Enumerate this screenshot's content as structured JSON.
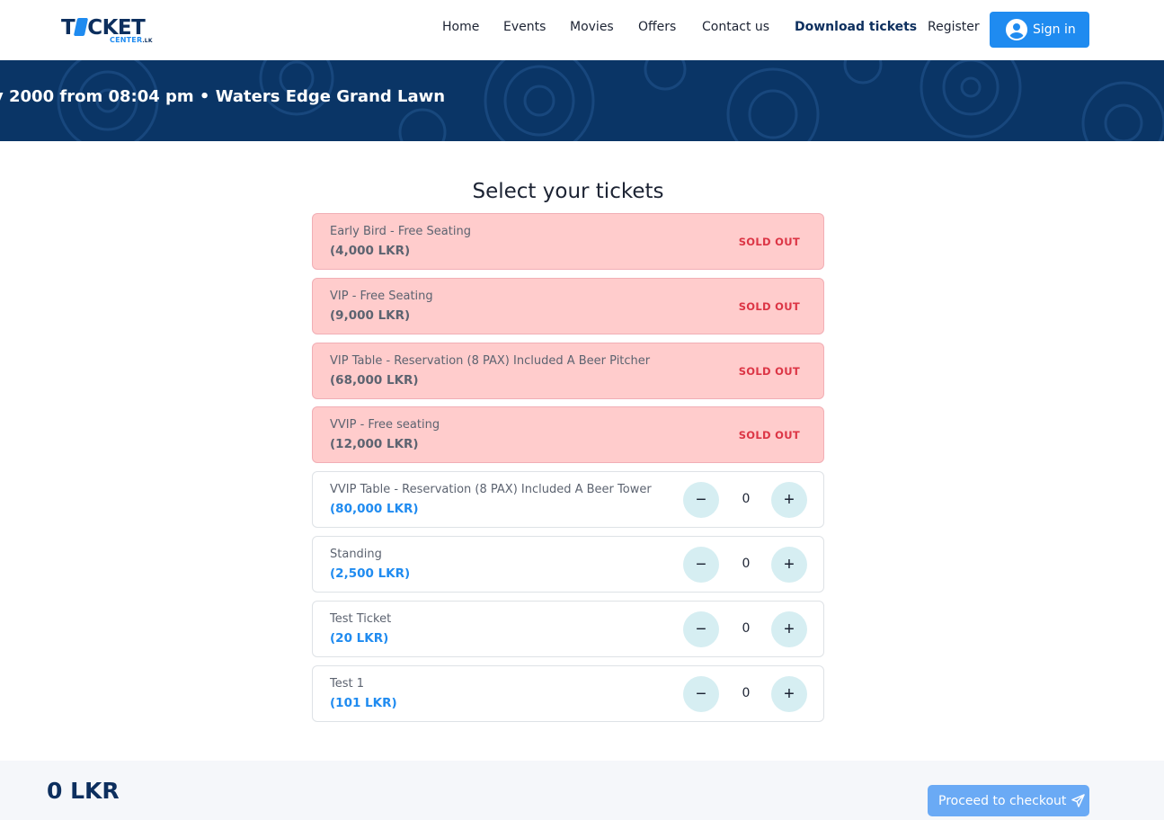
{
  "header": {
    "logo": {
      "main": "TICKET",
      "sub": "CENTER",
      "tld": ".LK"
    },
    "nav": [
      {
        "label": "Home",
        "active": false
      },
      {
        "label": "Events",
        "active": false
      },
      {
        "label": "Movies",
        "active": false
      },
      {
        "label": "Offers",
        "active": false
      },
      {
        "label": "Contact us",
        "active": false
      },
      {
        "label": "Download tickets",
        "active": true
      },
      {
        "label": "Register",
        "active": false
      }
    ],
    "signin_label": "Sign in"
  },
  "banner": {
    "text": "y 2000 from 08:04 pm • Waters Edge Grand Lawn"
  },
  "tickets_section": {
    "title": "Select your tickets",
    "sold_out_label": "SOLD OUT",
    "tickets": [
      {
        "name": "Early Bird - Free Seating",
        "price": "(4,000 LKR)",
        "status": "sold_out"
      },
      {
        "name": "VIP - Free Seating",
        "price": "(9,000 LKR)",
        "status": "sold_out"
      },
      {
        "name": "VIP Table - Reservation (8 PAX) Included A Beer Pitcher",
        "price": "(68,000 LKR)",
        "status": "sold_out"
      },
      {
        "name": "VVIP - Free seating",
        "price": "(12,000 LKR)",
        "status": "sold_out"
      },
      {
        "name": "VVIP Table - Reservation (8 PAX) Included A Beer Tower",
        "price": "(80,000 LKR)",
        "status": "available",
        "quantity": "0"
      },
      {
        "name": "Standing",
        "price": "(2,500 LKR)",
        "status": "available",
        "quantity": "0"
      },
      {
        "name": "Test Ticket",
        "price": "(20 LKR)",
        "status": "available",
        "quantity": "0"
      },
      {
        "name": "Test 1",
        "price": "(101 LKR)",
        "status": "available",
        "quantity": "0"
      }
    ]
  },
  "footer": {
    "total": "0 LKR",
    "checkout_label": "Proceed to checkout"
  },
  "colors": {
    "accent": "#1f8bf0",
    "navy": "#0d2f5e",
    "sold_bg": "#ffcccc",
    "sold_text": "#dc3545",
    "stepper_bg": "#d6eef2"
  }
}
